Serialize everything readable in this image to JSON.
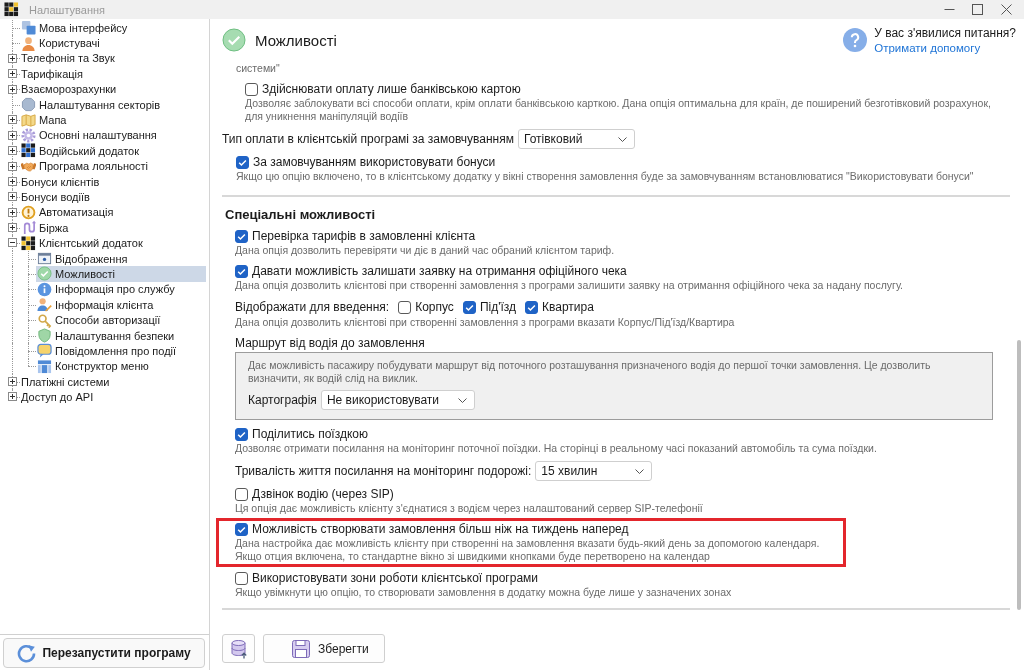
{
  "window": {
    "title": "Налаштування"
  },
  "sidebar": {
    "items": [
      {
        "label": "Мова інтерфейсу",
        "selected": false
      },
      {
        "label": "Користувачі",
        "selected": false
      },
      {
        "label": "Телефонія та Звук",
        "selected": false,
        "expanded": false
      },
      {
        "label": "Тарифікація",
        "selected": false,
        "expanded": false
      },
      {
        "label": "Взаєморозрахунки",
        "selected": false,
        "expanded": false
      },
      {
        "label": "Налаштування секторів",
        "selected": false
      },
      {
        "label": "Мапа",
        "selected": false,
        "expanded": false
      },
      {
        "label": "Основні налаштування",
        "selected": false,
        "expanded": false
      },
      {
        "label": "Водійський додаток",
        "selected": false,
        "expanded": false
      },
      {
        "label": "Програма лояльності",
        "selected": false,
        "expanded": false
      },
      {
        "label": "Бонуси клієнтів",
        "selected": false,
        "expanded": false
      },
      {
        "label": "Бонуси водіїв",
        "selected": false,
        "expanded": false
      },
      {
        "label": "Автоматизація",
        "selected": false,
        "expanded": false
      },
      {
        "label": "Біржа",
        "selected": false,
        "expanded": false
      },
      {
        "label": "Клієнтський додаток",
        "selected": false,
        "expanded": true,
        "children": [
          {
            "label": "Відображення",
            "selected": false
          },
          {
            "label": "Можливості",
            "selected": true
          },
          {
            "label": "Інформація про службу",
            "selected": false
          },
          {
            "label": "Інформація клієнта",
            "selected": false
          },
          {
            "label": "Способи авторизації",
            "selected": false
          },
          {
            "label": "Налаштування безпеки",
            "selected": false
          },
          {
            "label": "Повідомлення про події",
            "selected": false
          },
          {
            "label": "Конструктор меню",
            "selected": false
          }
        ]
      },
      {
        "label": "Платіжні системи",
        "selected": false,
        "expanded": false
      },
      {
        "label": "Доступ до API",
        "selected": false,
        "expanded": false
      }
    ],
    "restart_button": "Перезапустити програму"
  },
  "page": {
    "title": "Можливості",
    "help_question": "У вас з'явилися питання?",
    "help_link": "Отримати допомогу"
  },
  "content": {
    "options": [
      {
        "kind": "text",
        "description": "системи\"",
        "children": [
          {
            "kind": "checkbox",
            "label": "Здійснювати оплату лише банківською картою",
            "checked": false,
            "description": "Дозволяє заблокувати всі способи оплати, крім оплати банківською карткою. Дана опція оптимальна для країн, де поширений безготівковий розрахунок, для уникнення маніпуляцій водіїв"
          }
        ]
      },
      {
        "kind": "select",
        "label": "Тип оплати в клієнтській програмі за замовчуванням",
        "value": "Готівковий"
      },
      {
        "kind": "checkbox",
        "label": "За замовчуванням використовувати бонуси",
        "checked": true,
        "description": "Якщо цю опцію включено, то в клієнтському додатку у вікні створення замовлення буде за замовчуванням встановлюватися \"Використовувати бонуси\""
      }
    ],
    "sections": [
      {
        "title": "Спеціальні можливості",
        "options": [
          {
            "kind": "checkbox",
            "label": "Перевірка тарифів в замовленні клієнта",
            "checked": true,
            "highlighted": false,
            "description": "Дана опція дозволить перевіряти чи діє в даний час обраний клієнтом тариф."
          },
          {
            "kind": "checkbox",
            "label": "Давати можливість залишати заявку на отримання офіційного чека",
            "checked": true,
            "highlighted": false,
            "description": "Дана опція дозволить клієнтові при створенні замовлення з програми залишити заявку на отримання офіційного чека за надану послугу."
          },
          {
            "kind": "checks",
            "label": "Відображати для введення:",
            "items": [
              {
                "label": "Корпус",
                "checked": false
              },
              {
                "label": "Під'їзд",
                "checked": true
              },
              {
                "label": "Квартира",
                "checked": true
              }
            ],
            "description": "Дана опція дозволить клієнтові при створенні замовлення з програми вказати Корпус/Під'їзд/Квартира"
          },
          {
            "kind": "group",
            "label": "Маршрут від водія до замовлення",
            "description": "Дає можливість пасажиру побудувати маршрут від поточного розташування призначеного водія до першої точки замовлення. Це дозволить визначити, як водій слід на виклик.",
            "field": {
              "label": "Картографія",
              "value": "Не використовувати"
            }
          },
          {
            "kind": "checkbox",
            "label": "Поділитись поїздкою",
            "checked": true,
            "highlighted": false,
            "description": "Дозволяє отримати посилання на моніторинг поточної поїздки. На сторінці в реальному часі показаний автомобіль та сума поїздки."
          },
          {
            "kind": "select",
            "label": "Тривалість життя посилання на моніторинг подорожі:",
            "value": "15 хвилин"
          },
          {
            "kind": "checkbox",
            "label": "Дзвінок водію (через SIP)",
            "checked": false,
            "highlighted": false,
            "description": "Ця опція дає можливість клієнту з'єднатися з водієм через налаштований сервер SIP-телефонії"
          },
          {
            "kind": "checkbox",
            "label": "Можливість створювати замовлення більш ніж на тиждень наперед",
            "checked": true,
            "highlighted": true,
            "description": "Дана настройка дає можливість клієнту при створенні на замовлення вказати будь-який день за допомогою календаря.\nЯкщо отция включена, то стандартне вікно зі швидкими кнопками буде перетворено на календар"
          },
          {
            "kind": "checkbox",
            "label": "Використовувати зони роботи клієнтської програми",
            "checked": false,
            "highlighted": false,
            "description": "Якщо увімкнути цю опцію, то створювати замовлення в додатку можна буде лише у зазначених зонах"
          }
        ]
      }
    ],
    "save_button": "Зберегти"
  }
}
